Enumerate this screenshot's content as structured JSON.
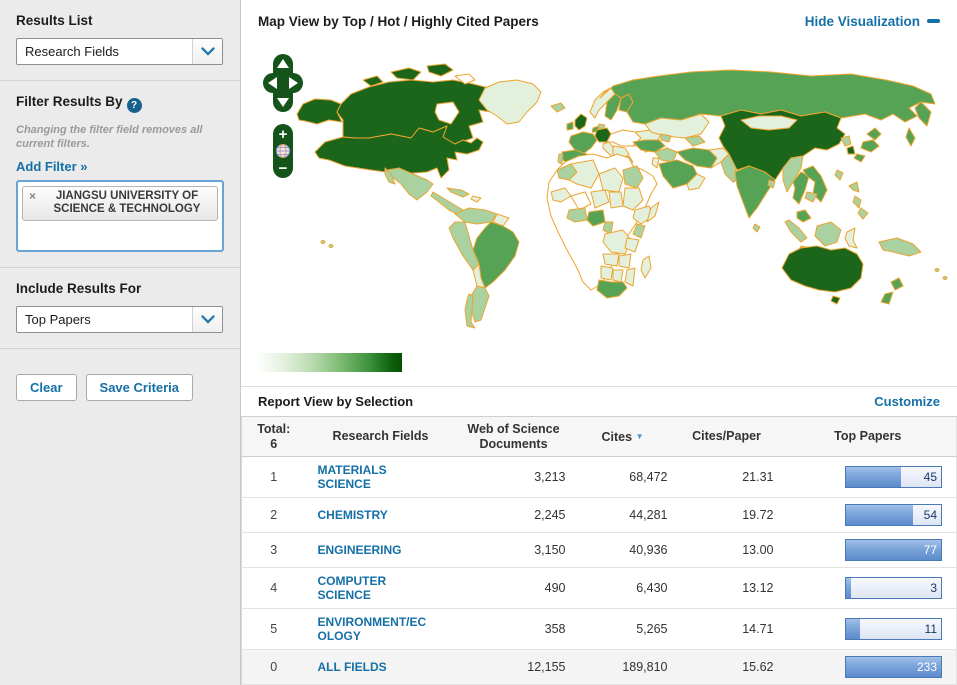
{
  "sidebar": {
    "results_list_label": "Results List",
    "results_list_value": "Research Fields",
    "filter_heading": "Filter Results By",
    "filter_help": "?",
    "filter_note": "Changing the filter field removes all current filters.",
    "add_filter_label": "Add Filter »",
    "filter_tag": "JIANGSU UNIVERSITY OF SCIENCE & TECHNOLOGY",
    "filter_tag_remove": "×",
    "include_label": "Include Results For",
    "include_value": "Top Papers",
    "clear_button": "Clear",
    "save_button": "Save Criteria"
  },
  "map_panel": {
    "title": "Map View by Top / Hot / Highly Cited Papers",
    "hide_visualization_label": "Hide Visualization",
    "controls": {
      "zoom_in": "+",
      "zoom_out": "−"
    },
    "legend_gradient": [
      "#ffffff",
      "#045004"
    ],
    "choropleth_palette": {
      "none": "#ffffff",
      "very_low": "#e3f0dc",
      "low": "#a9d2a0",
      "medium": "#56a356",
      "high": "#1b661b",
      "border": "#eda42e"
    },
    "regions": {
      "canada": "high",
      "united_states": "high",
      "alaska": "high",
      "greenland": "very_low",
      "mexico": "low",
      "central_america": "low",
      "colombia_venezuela": "low",
      "brazil": "medium",
      "peru": "low",
      "argentina": "low",
      "chile": "low",
      "united_kingdom": "high",
      "ireland": "medium",
      "france": "medium",
      "spain": "medium",
      "portugal": "low",
      "germany": "high",
      "italy": "very_low",
      "norway": "very_low",
      "sweden": "medium",
      "finland": "medium",
      "eastern_europe": "very_low",
      "russia": "medium",
      "kazakhstan": "very_low",
      "mongolia": "very_low",
      "china": "high",
      "japan": "medium",
      "south_korea": "high",
      "india": "medium",
      "pakistan": "low",
      "iran": "medium",
      "saudi_arabia": "medium",
      "turkey": "medium",
      "north_africa": "very_low",
      "egypt": "low",
      "nigeria": "medium",
      "south_africa": "medium",
      "thailand": "medium",
      "vietnam": "medium",
      "malaysia": "medium",
      "indonesia": "low",
      "philippines": "low",
      "new_guinea": "low",
      "australia": "high",
      "new_zealand": "medium"
    }
  },
  "report": {
    "title": "Report View by Selection",
    "customize_label": "Customize",
    "table": {
      "total_label": "Total:",
      "total_value": "6",
      "columns": [
        "Research Fields",
        "Web of Science Documents",
        "Cites",
        "Cites/Paper",
        "Top Papers"
      ],
      "sort_column": "Cites",
      "sort_indicator": "▼",
      "rows": [
        {
          "rank": "1",
          "field": "MATERIALS SCIENCE",
          "docs": "3,213",
          "cites": "68,472",
          "cites_per_paper": "21.31",
          "top_papers": "45",
          "bar_pct": 58,
          "summary": false
        },
        {
          "rank": "2",
          "field": "CHEMISTRY",
          "docs": "2,245",
          "cites": "44,281",
          "cites_per_paper": "19.72",
          "top_papers": "54",
          "bar_pct": 70,
          "summary": false
        },
        {
          "rank": "3",
          "field": "ENGINEERING",
          "docs": "3,150",
          "cites": "40,936",
          "cites_per_paper": "13.00",
          "top_papers": "77",
          "bar_pct": 100,
          "summary": false
        },
        {
          "rank": "4",
          "field": "COMPUTER SCIENCE",
          "docs": "490",
          "cites": "6,430",
          "cites_per_paper": "13.12",
          "top_papers": "3",
          "bar_pct": 5,
          "summary": false
        },
        {
          "rank": "5",
          "field": "ENVIRONMENT/ECOLOGY",
          "docs": "358",
          "cites": "5,265",
          "cites_per_paper": "14.71",
          "top_papers": "11",
          "bar_pct": 15,
          "summary": false
        },
        {
          "rank": "0",
          "field": "ALL FIELDS",
          "docs": "12,155",
          "cites": "189,810",
          "cites_per_paper": "15.62",
          "top_papers": "233",
          "bar_pct": 100,
          "summary": true
        }
      ]
    }
  }
}
